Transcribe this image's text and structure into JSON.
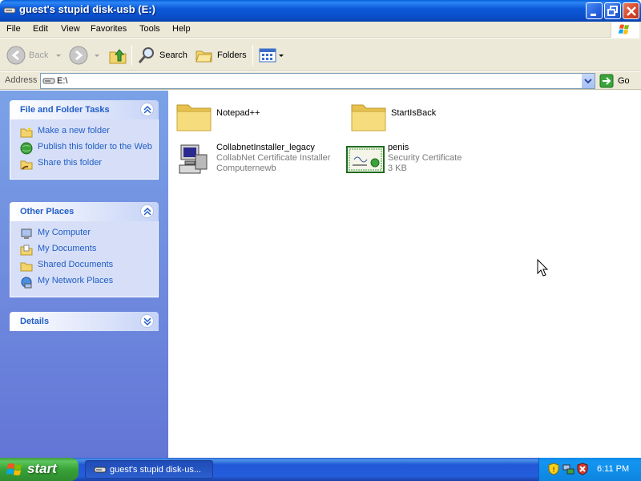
{
  "window": {
    "title": "guest's stupid disk-usb (E:)"
  },
  "menu": [
    "File",
    "Edit",
    "View",
    "Favorites",
    "Tools",
    "Help"
  ],
  "toolbar": {
    "back": "Back",
    "search": "Search",
    "folders": "Folders"
  },
  "address": {
    "label": "Address",
    "value": "E:\\",
    "go": "Go"
  },
  "sidebar": {
    "file_tasks": {
      "title": "File and Folder Tasks",
      "items": [
        "Make a new folder",
        "Publish this folder to the Web",
        "Share this folder"
      ]
    },
    "other_places": {
      "title": "Other Places",
      "items": [
        "My Computer",
        "My Documents",
        "Shared Documents",
        "My Network Places"
      ]
    },
    "details": {
      "title": "Details"
    }
  },
  "files": [
    {
      "name": "Notepad++",
      "type": "folder"
    },
    {
      "name": "StartIsBack",
      "type": "folder"
    },
    {
      "name": "CollabnetInstaller_legacy",
      "desc": "CollabNet Certificate Installer",
      "extra": "Computernewb",
      "type": "installer"
    },
    {
      "name": "penis",
      "desc": "Security Certificate",
      "extra": "3 KB",
      "type": "certificate"
    }
  ],
  "taskbar": {
    "start": "start",
    "task": "guest's stupid disk-us...",
    "clock": "6:11 PM"
  },
  "colors": {
    "title": "#0a4ec8",
    "sidebar_link": "#215dc6",
    "start": "#37a337",
    "tray": "#0f8be8"
  }
}
